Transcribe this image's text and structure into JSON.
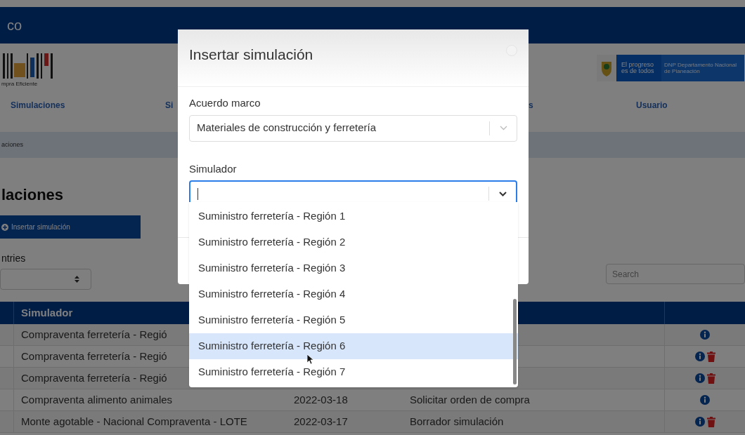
{
  "top_bar": {
    "title": "co"
  },
  "header": {
    "logo_caption": "mpra Eficiente",
    "gov_logo": {
      "slogan": "El progreso es de todos",
      "entity": "DNP Departamento Nacional de Planeación"
    }
  },
  "nav": [
    {
      "label": "Simulaciones"
    },
    {
      "label": "Si"
    },
    {
      "label": "s"
    },
    {
      "label": "Usuario"
    }
  ],
  "breadcrumb": "aciones",
  "page_title": "laciones",
  "insert_button": "Insertar simulación",
  "entries_label": "ntries",
  "search": {
    "placeholder": "Search"
  },
  "table": {
    "columns": [
      "Simulador"
    ],
    "rows": [
      {
        "cells": [
          "Compraventa ferretería - Regió"
        ],
        "actions": [
          {
            "kind": "info"
          }
        ]
      },
      {
        "cells": [
          "Compraventa ferretería - Regió"
        ],
        "actions": [
          {
            "kind": "info"
          },
          {
            "kind": "delete"
          }
        ]
      },
      {
        "cells": [
          "Compraventa ferretería - Regió"
        ],
        "actions": [
          {
            "kind": "info"
          },
          {
            "kind": "delete"
          }
        ]
      },
      {
        "cells": [
          "Compraventa alimento animales",
          "2022-03-18",
          "Solicitar orden de compra"
        ],
        "actions": [
          {
            "kind": "info"
          }
        ]
      },
      {
        "cells": [
          "Monte agotable - Nacional Compraventa - LOTE",
          "2022-03-17",
          "Borrador simulación"
        ],
        "actions": [
          {
            "kind": "info"
          },
          {
            "kind": "delete"
          }
        ]
      }
    ]
  },
  "modal": {
    "title": "Insertar simulación",
    "fields": [
      {
        "label": "Acuerdo marco",
        "value": "Materiales de construcción y ferretería",
        "focused": false
      },
      {
        "label": "Simulador",
        "focused": true
      }
    ],
    "dropdown": {
      "options": [
        {
          "label": "Suministro ferretería - Región 1",
          "selected": false
        },
        {
          "label": "Suministro ferretería - Región 2",
          "selected": false
        },
        {
          "label": "Suministro ferretería - Región 3",
          "selected": false
        },
        {
          "label": "Suministro ferretería - Región 4",
          "selected": false
        },
        {
          "label": "Suministro ferretería - Región 5",
          "selected": false
        },
        {
          "label": "Suministro ferretería - Región 6",
          "selected": true
        },
        {
          "label": "Suministro ferretería - Región 7",
          "selected": false
        }
      ]
    }
  }
}
